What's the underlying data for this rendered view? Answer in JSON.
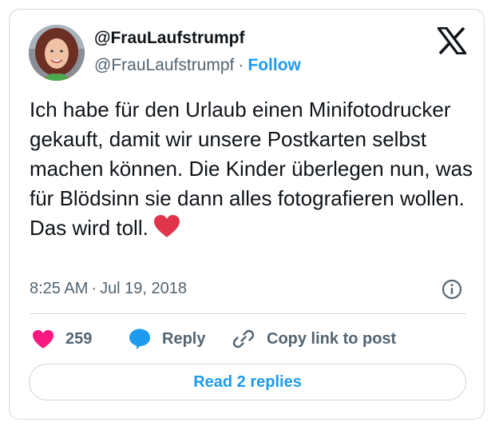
{
  "author": {
    "display_name": "@FrauLaufstrumpf",
    "handle": "@FrauLaufstrumpf",
    "separator": "·",
    "follow_label": "Follow",
    "avatar_icon": "profile-photo-avatar"
  },
  "tweet": {
    "text": "Ich habe für den Urlaub einen Minifotodrucker gekauft, damit wir unsere Postkarten selbst machen können. Die Kinder überlegen nun, was für Blödsinn sie dann alles fotografieren wollen. Das wird toll.",
    "emoji": "red-heart-emoji",
    "time": "8:25 AM",
    "separator": "·",
    "date": "Jul 19, 2018"
  },
  "actions": {
    "like_count": "259",
    "reply_label": "Reply",
    "copy_link_label": "Copy link to post"
  },
  "replies_button": {
    "label": "Read 2 replies"
  },
  "icons": {
    "brand": "x-logo-icon",
    "info": "info-icon",
    "like": "heart-icon",
    "reply": "speech-bubble-icon",
    "copy": "link-icon"
  },
  "colors": {
    "accent": "#1d9bf0",
    "like": "#f91880",
    "text": "#0f1419",
    "muted": "#536471",
    "border": "#cfd9de",
    "emoji_heart": "#e0344b"
  }
}
